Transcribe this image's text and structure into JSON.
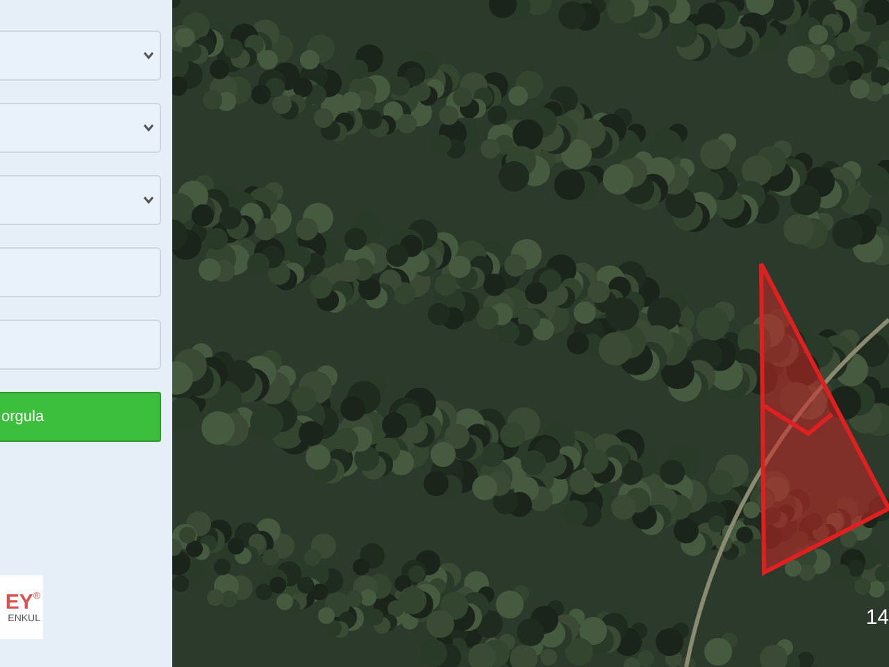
{
  "sidebar": {
    "fields": [
      {
        "kind": "select"
      },
      {
        "kind": "select"
      },
      {
        "kind": "select"
      },
      {
        "kind": "text"
      },
      {
        "kind": "text"
      }
    ],
    "query_button": {
      "label": "orgula"
    },
    "logo": {
      "name": "EY",
      "mark": "®",
      "subtitle": "ENKUL"
    }
  },
  "map": {
    "corner_label": "14"
  }
}
